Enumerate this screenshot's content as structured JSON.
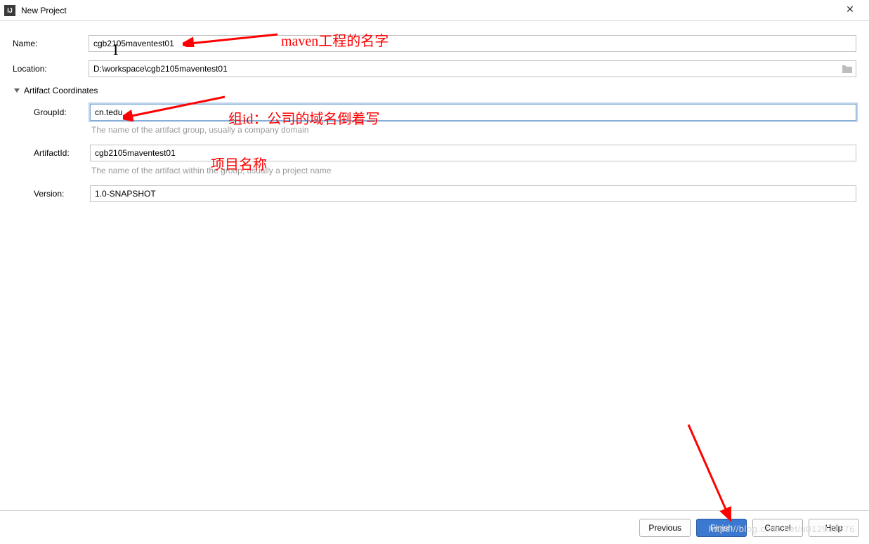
{
  "window": {
    "title": "New Project",
    "close_tooltip": "Close"
  },
  "form": {
    "name": {
      "label": "Name:",
      "value": "cgb2105maventest01"
    },
    "location": {
      "label": "Location:",
      "value": "D:\\workspace\\cgb2105maventest01"
    },
    "artifactSection": {
      "header": "Artifact Coordinates"
    },
    "groupId": {
      "label": "GroupId:",
      "value": "cn.tedu",
      "hint": "The name of the artifact group, usually a company domain"
    },
    "artifactId": {
      "label": "ArtifactId:",
      "value": "cgb2105maventest01",
      "hint": "The name of the artifact within the group, usually a project name"
    },
    "version": {
      "label": "Version:",
      "value": "1.0-SNAPSHOT"
    }
  },
  "buttons": {
    "previous": "Previous",
    "finish": "Finish",
    "cancel": "Cancel",
    "help": "Help"
  },
  "annotations": {
    "a1": "maven工程的名字",
    "a2": "组id：公司的域名倒着写",
    "a3": "项目名称"
  },
  "watermark": "https://blog.csdn.net/u012932876"
}
